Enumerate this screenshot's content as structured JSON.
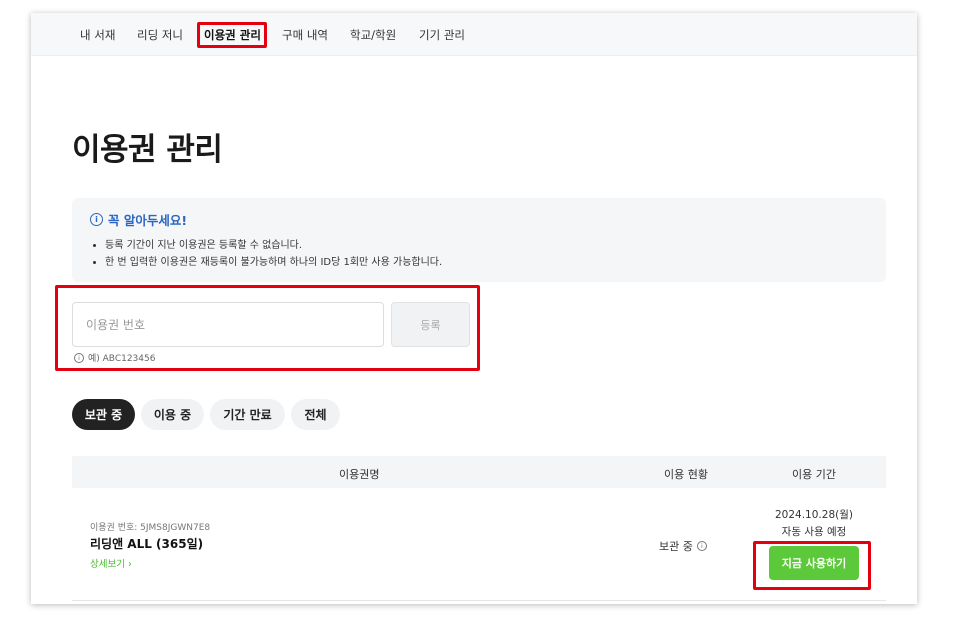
{
  "nav": {
    "items": [
      "내 서재",
      "리딩 저니",
      "이용권 관리",
      "구매 내역",
      "학교/학원",
      "기기 관리"
    ],
    "active_index": 2
  },
  "page": {
    "title": "이용권 관리"
  },
  "notice": {
    "title": "꼭 알아두세요!",
    "lines": [
      "등록 기간이 지난 이용권은 등록할 수 없습니다.",
      "한 번 입력한 이용권은 재등록이 불가능하며 하나의 ID당 1회만 사용 가능합니다."
    ],
    "icon": "info-circle-icon"
  },
  "register": {
    "placeholder": "이용권 번호",
    "value": "",
    "button_label": "등록",
    "hint": "예) ABC123456"
  },
  "filters": {
    "items": [
      "보관 중",
      "이용 중",
      "기간 만료",
      "전체"
    ],
    "active_index": 0
  },
  "table": {
    "headers": [
      "이용권명",
      "이용 현황",
      "이용 기간"
    ],
    "rows": [
      {
        "serial": "이용권 번호: 5JMS8JGWN7E8",
        "name": "리딩앤 ALL (365일)",
        "detail_label": "상세보기 ›",
        "status": "보관 중",
        "date": "2024.10.28(월)",
        "auto_note": "자동 사용 예정",
        "action_label": "지금 사용하기"
      }
    ]
  },
  "colors": {
    "highlight": "#e4000f",
    "accent_green": "#5bc939",
    "notice_blue": "#2a66c2"
  }
}
